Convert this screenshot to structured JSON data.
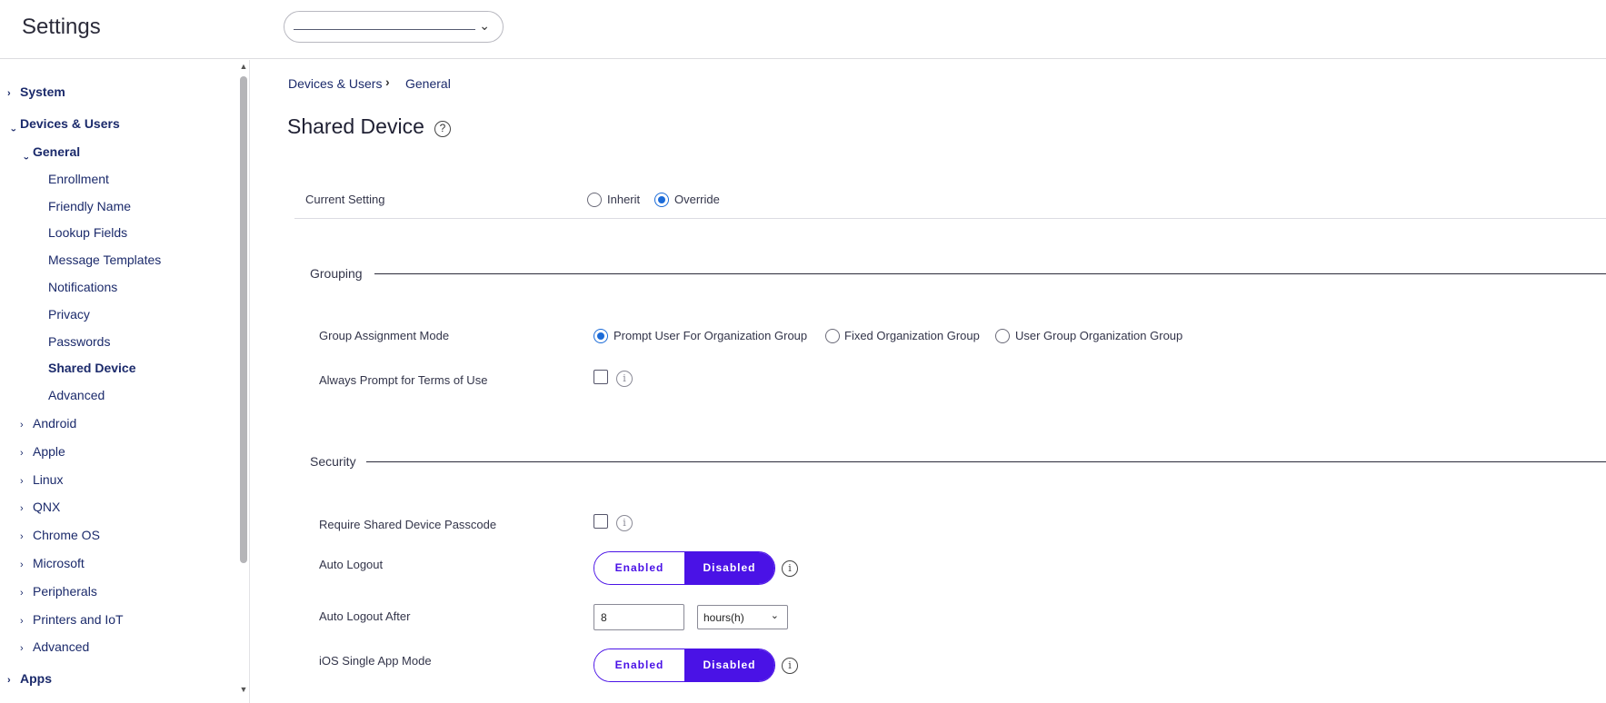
{
  "header": {
    "title": "Settings",
    "org_selector_value": ""
  },
  "sidebar": {
    "items": [
      {
        "label": "System",
        "caret": "›"
      },
      {
        "label": "Devices & Users",
        "caret": "‹"
      },
      {
        "label": "General",
        "caret": "‹"
      },
      {
        "label": "Enrollment"
      },
      {
        "label": "Friendly Name"
      },
      {
        "label": "Lookup Fields"
      },
      {
        "label": "Message Templates"
      },
      {
        "label": "Notifications"
      },
      {
        "label": "Privacy"
      },
      {
        "label": "Passwords"
      },
      {
        "label": "Shared Device"
      },
      {
        "label": "Advanced"
      },
      {
        "label": "Android",
        "caret": "›"
      },
      {
        "label": "Apple",
        "caret": "›"
      },
      {
        "label": "Linux",
        "caret": "›"
      },
      {
        "label": "QNX",
        "caret": "›"
      },
      {
        "label": "Chrome OS",
        "caret": "›"
      },
      {
        "label": "Microsoft",
        "caret": "›"
      },
      {
        "label": "Peripherals",
        "caret": "›"
      },
      {
        "label": "Printers and IoT",
        "caret": "›"
      },
      {
        "label": "Advanced",
        "caret": "›"
      },
      {
        "label": "Apps",
        "caret": "›"
      }
    ],
    "selected": "Shared Device"
  },
  "breadcrumb": {
    "items": [
      "Devices & Users",
      "General"
    ],
    "separator": "›"
  },
  "page": {
    "title": "Shared Device",
    "help_icon": "?"
  },
  "current_setting": {
    "label": "Current Setting",
    "options": [
      "Inherit",
      "Override"
    ],
    "selected": "Override"
  },
  "grouping": {
    "title": "Grouping",
    "group_assignment_mode": {
      "label": "Group Assignment Mode",
      "options": [
        "Prompt User For Organization Group",
        "Fixed Organization Group",
        "User Group Organization Group"
      ],
      "selected": "Prompt User For Organization Group"
    },
    "always_prompt_terms": {
      "label": "Always Prompt for Terms of Use",
      "checked": false,
      "info_icon": "i"
    }
  },
  "security": {
    "title": "Security",
    "require_passcode": {
      "label": "Require Shared Device Passcode",
      "checked": false,
      "info_icon": "i"
    },
    "auto_logout": {
      "label": "Auto Logout",
      "enabled_label": "Enabled",
      "disabled_label": "Disabled",
      "value": "Disabled",
      "info_icon": "i"
    },
    "auto_logout_after": {
      "label": "Auto Logout After",
      "value": "8",
      "unit": "hours(h)"
    },
    "ios_single_app_mode": {
      "label": "iOS Single App Mode",
      "enabled_label": "Enabled",
      "disabled_label": "Disabled",
      "value": "Disabled",
      "info_icon": "i"
    }
  },
  "colors": {
    "accent": "#4a12e6",
    "radio_selected": "#1b6bd8",
    "nav_text": "#1b2a6b"
  },
  "icons": {
    "chevron": "⌄",
    "scroll_up": "▲",
    "scroll_down": "▼"
  }
}
